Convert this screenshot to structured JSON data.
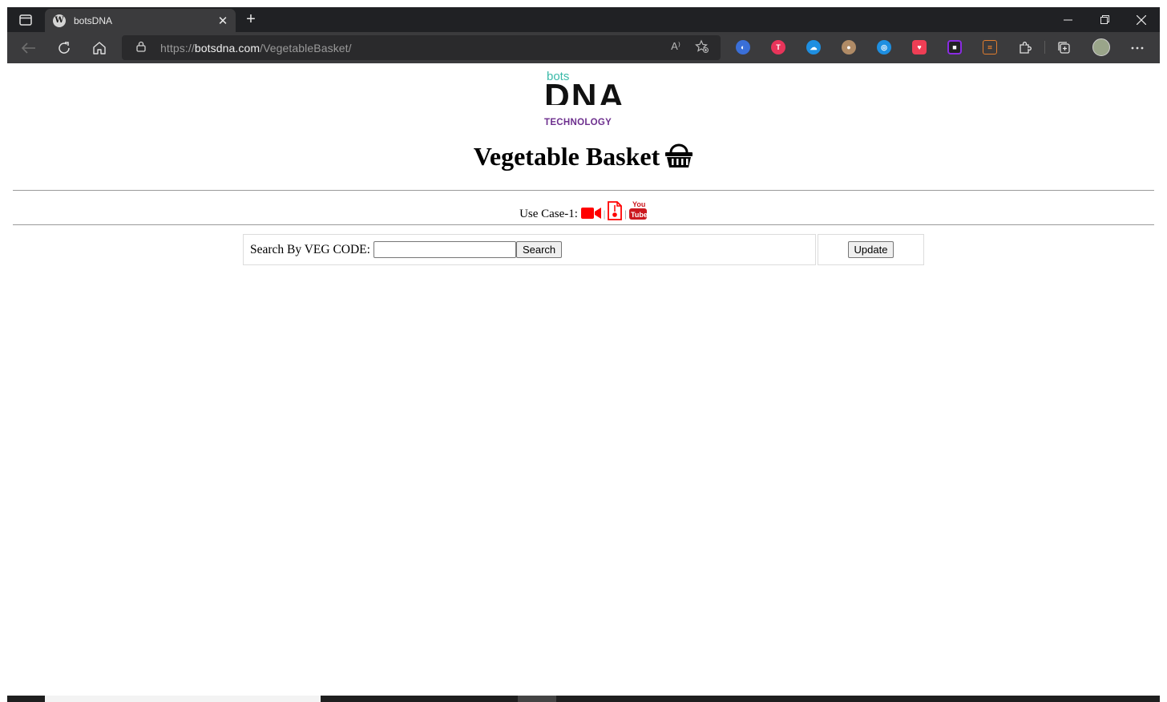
{
  "browser": {
    "tab_title": "botsDNA",
    "tab_close": "✕",
    "new_tab": "+",
    "url_scheme": "https://",
    "url_host": "botsdna.com",
    "url_path": "/VegetableBasket/",
    "read_aloud": "A⁾",
    "icons": {
      "tab_actions": "tab-actions-icon",
      "back": "back-arrow-icon",
      "refresh": "refresh-icon",
      "home": "home-icon",
      "lock": "lock-icon",
      "favorites": "add-favorite-icon",
      "extensions": "puzzle-icon",
      "collections": "collections-icon",
      "more": "more-icon"
    },
    "extension_colors": [
      "#3a6fd8",
      "#e8345a",
      "#1e8fe1",
      "#b08b66",
      "#1e8fe1",
      "#ef3e55",
      "#8a2be2",
      "#e07d2e"
    ]
  },
  "page": {
    "logo": {
      "bots": "bots",
      "dna": "DNA",
      "technology": "TECHNOLOGY"
    },
    "heading": "Vegetable Basket",
    "use_case_label": "Use Case-1:",
    "use_case_icons": [
      "video-camera-icon",
      "pdf-file-icon",
      "youtube-icon"
    ],
    "search_label": "Search By VEG CODE:",
    "search_value": "",
    "search_button": "Search",
    "update_button": "Update"
  }
}
